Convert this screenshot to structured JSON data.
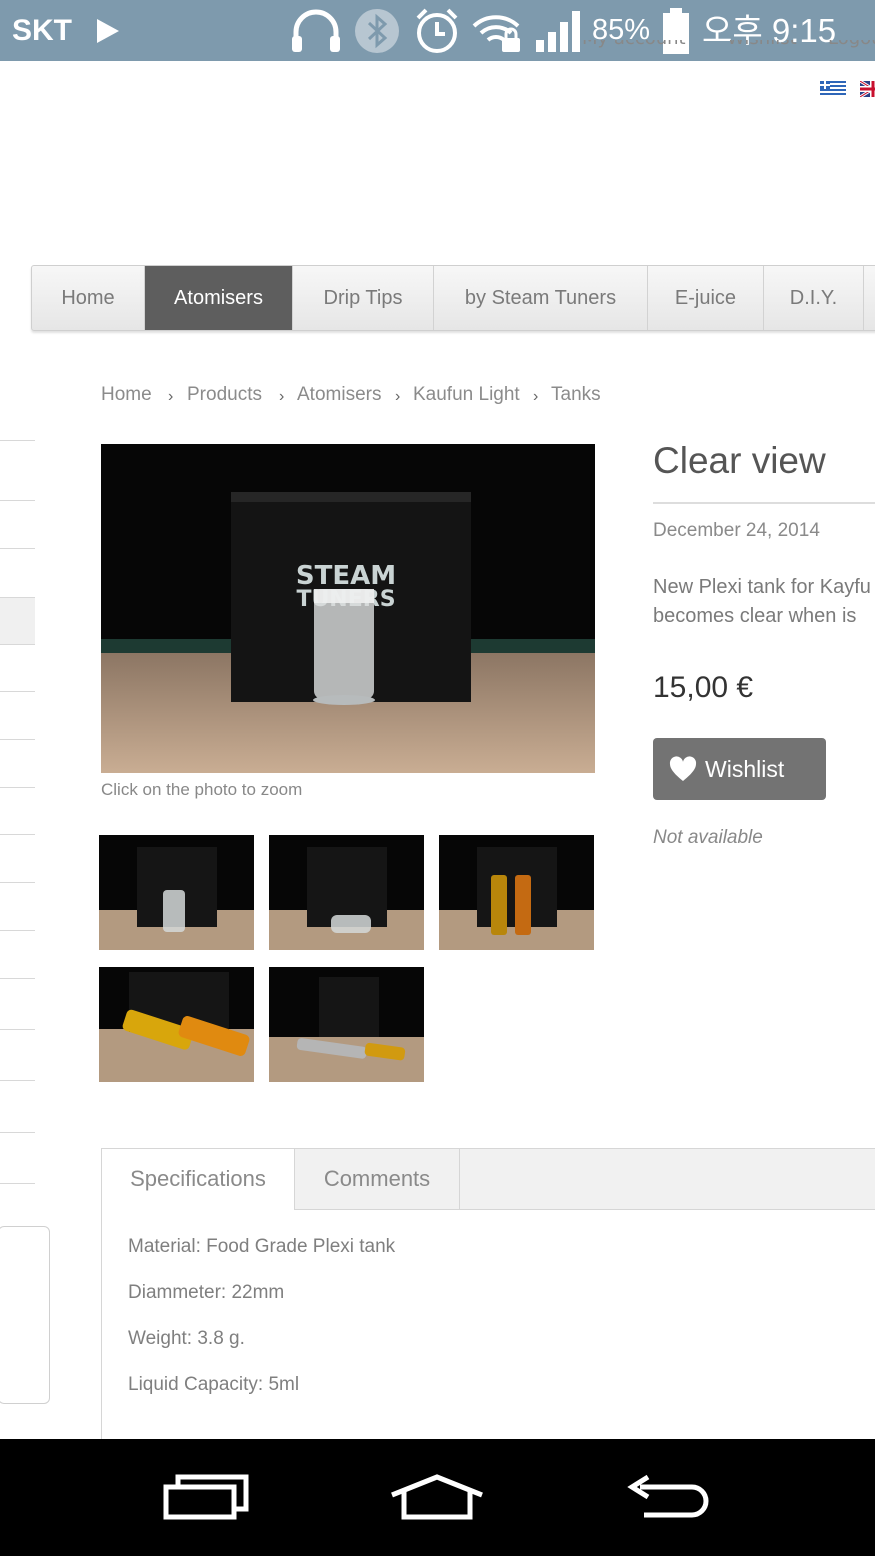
{
  "status_bar": {
    "carrier": "SKT",
    "battery": "85%",
    "time": "오후 9:15",
    "icons": [
      "play-icon",
      "headphones-icon",
      "bluetooth-icon",
      "alarm-icon",
      "wifi-lock-icon",
      "signal-icon",
      "battery-icon"
    ]
  },
  "header": {
    "links": [
      "My account",
      "Wishlist",
      "Logout"
    ],
    "languages": [
      "greek-flag-icon",
      "uk-flag-icon"
    ]
  },
  "nav": {
    "items": [
      {
        "label": "Home",
        "active": false
      },
      {
        "label": "Atomisers",
        "active": true
      },
      {
        "label": "Drip Tips",
        "active": false
      },
      {
        "label": "by Steam Tuners",
        "active": false
      },
      {
        "label": "E-juice",
        "active": false
      },
      {
        "label": "D.I.Y.",
        "active": false
      }
    ],
    "active_color": "#5e5e5e"
  },
  "breadcrumb": [
    "Home",
    "Products",
    "Atomisers",
    "Kaufun Light",
    "Tanks"
  ],
  "gallery": {
    "zoom_hint": "Click on the photo to zoom",
    "main_logo_text_1": "STEAM",
    "main_logo_text_2": "TUNERS",
    "thumbnails": [
      "thumb-clear-tank",
      "thumb-tank-side",
      "thumb-two-tanks-upright",
      "thumb-tanks-lying",
      "thumb-tank-with-tube"
    ]
  },
  "product": {
    "title": "Clear view",
    "date": "December 24, 2014",
    "description_line1": "New Plexi tank for Kayfu",
    "description_line2": "becomes clear when is",
    "price": "15,00 €",
    "wishlist_label": "Wishlist",
    "availability": "Not available"
  },
  "tabs": {
    "items": [
      {
        "label": "Specifications",
        "active": true
      },
      {
        "label": "Comments",
        "active": false
      }
    ],
    "specifications": [
      "Material: Food Grade Plexi tank",
      "Diammeter: 22mm",
      "Weight: 3.8 g.",
      "Liquid Capacity: 5ml"
    ]
  },
  "system_nav": [
    "recent-apps-icon",
    "home-icon",
    "back-icon"
  ]
}
